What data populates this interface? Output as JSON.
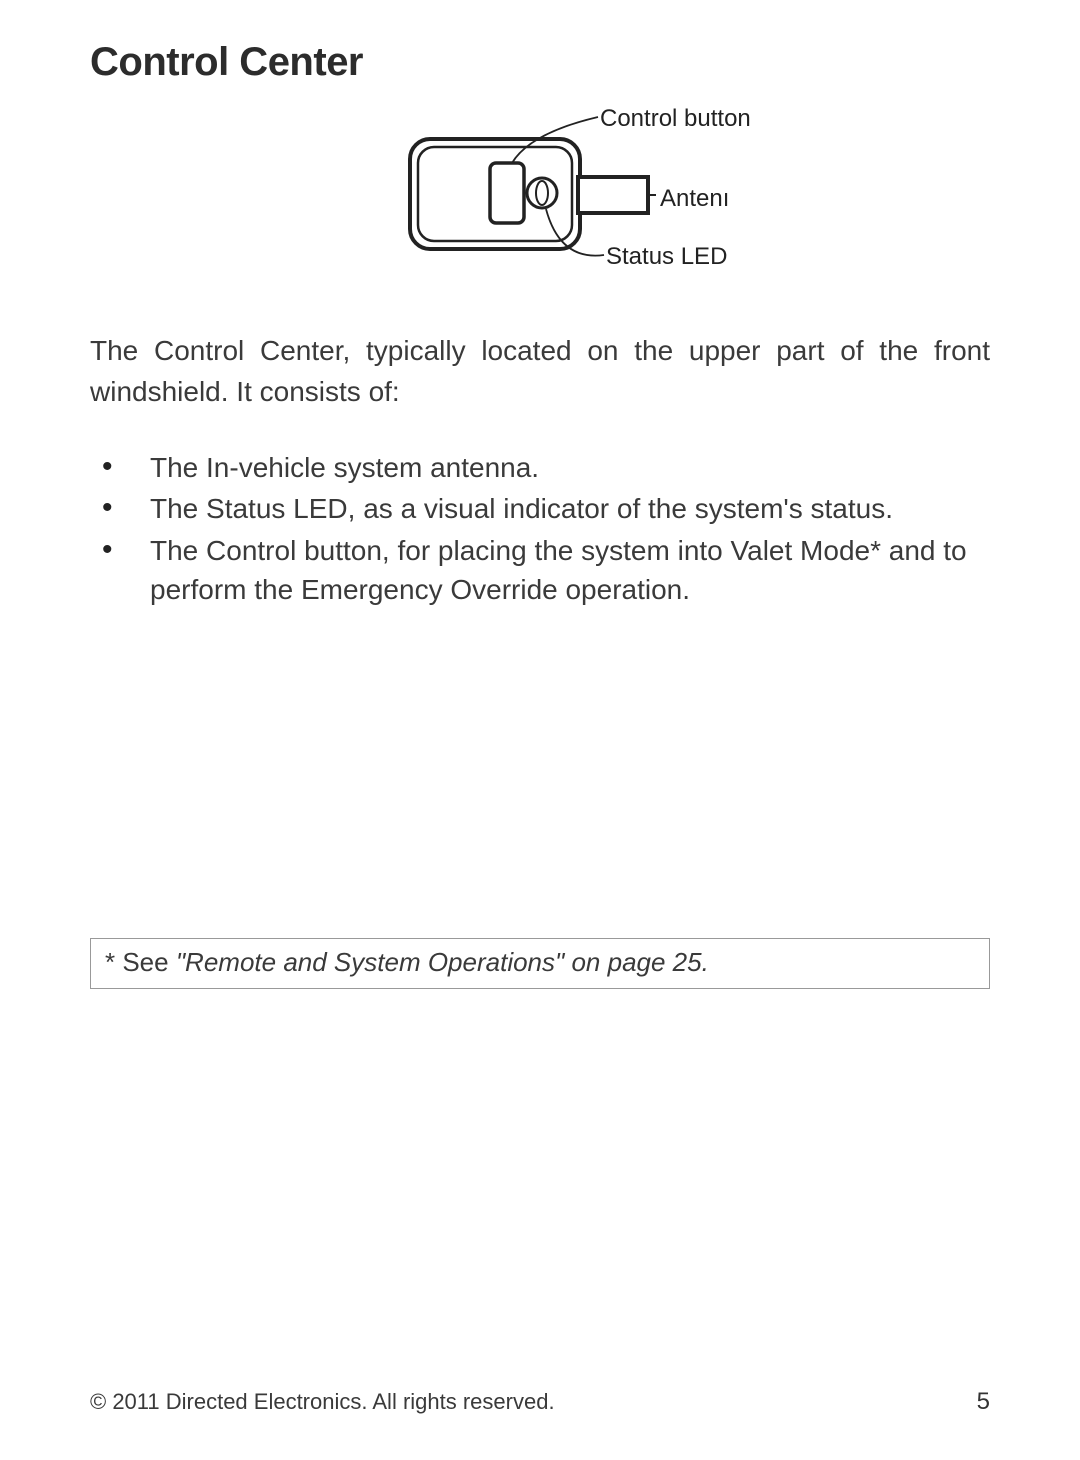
{
  "heading": "Control Center",
  "diagram": {
    "label_control_button": "Control button",
    "label_antenna": "Antenı",
    "label_status_led": "Status LED"
  },
  "intro": "The Control Center, typically located on the upper part of the front windshield. It consists of:",
  "bullets": [
    "The In-vehicle system antenna.",
    "The Status LED, as  a visual indicator of the system's status.",
    "The Control button, for placing the system into Valet Mode* and to perform the Emergency Override operation."
  ],
  "footnote_prefix": "* See ",
  "footnote_ref": "\"Remote and System Operations\" on page 25.",
  "copyright": "© 2011 Directed Electronics. All rights reserved.",
  "page_number": "5"
}
